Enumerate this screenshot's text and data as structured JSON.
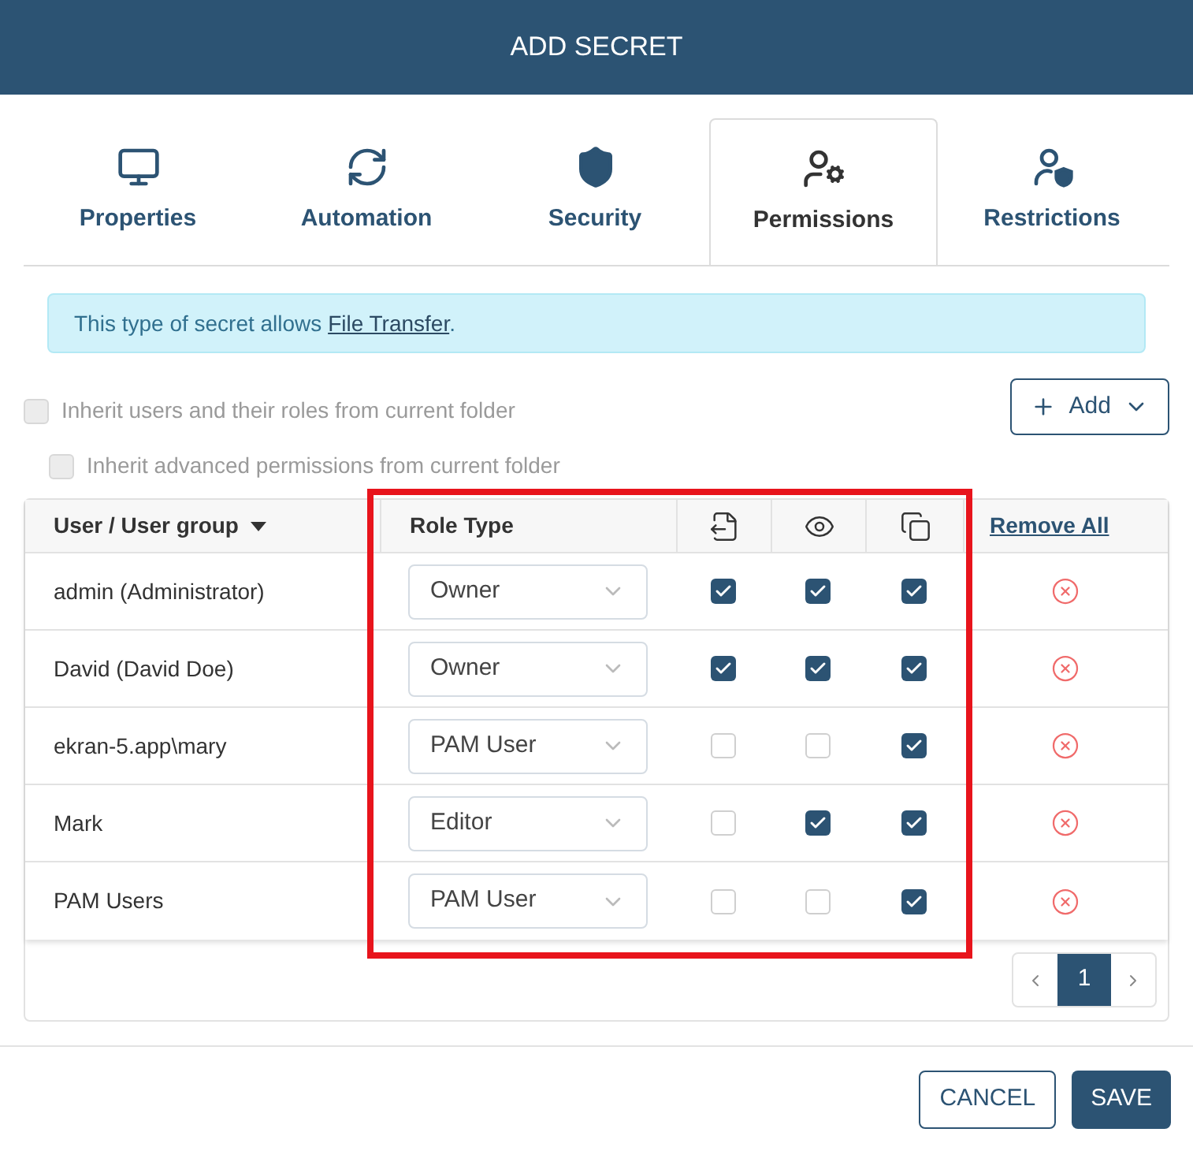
{
  "dialog": {
    "title": "ADD SECRET"
  },
  "tabs": [
    {
      "label": "Properties",
      "selected": false,
      "kind": "properties"
    },
    {
      "label": "Automation",
      "selected": false,
      "kind": "automation"
    },
    {
      "label": "Security",
      "selected": false,
      "kind": "security"
    },
    {
      "label": "Permissions",
      "selected": true,
      "kind": "permissions"
    },
    {
      "label": "Restrictions",
      "selected": false,
      "kind": "restrictions"
    }
  ],
  "notice": {
    "text": "This type of secret allows ",
    "link": "File Transfer",
    "end": "."
  },
  "options": [
    {
      "label": "Inherit users and their roles from current folder",
      "checked": false,
      "disabled": true
    },
    {
      "label": "Inherit advanced permissions from current folder",
      "checked": false,
      "disabled": true
    }
  ],
  "add_button": "Add",
  "table": {
    "columns": [
      "User / User group",
      "Role Type"
    ],
    "remove_all": "Remove All",
    "rows": [
      {
        "user": "admin (Administrator)",
        "role": "Owner",
        "transfer": true,
        "view": true,
        "copy": true
      },
      {
        "user": "David (David Doe)",
        "role": "Owner",
        "transfer": true,
        "view": true,
        "copy": true
      },
      {
        "user": "ekran-5.app\\mary",
        "role": "PAM User",
        "transfer": false,
        "view": false,
        "copy": true
      },
      {
        "user": "Mark",
        "role": "Editor",
        "transfer": false,
        "view": true,
        "copy": true
      },
      {
        "user": "PAM Users",
        "role": "PAM User",
        "transfer": false,
        "view": false,
        "copy": true
      }
    ]
  },
  "pagination": {
    "pages": [
      {
        "label": "1",
        "selected": true
      }
    ]
  },
  "buttons": {
    "cancel": "CANCEL",
    "save": "SAVE"
  }
}
